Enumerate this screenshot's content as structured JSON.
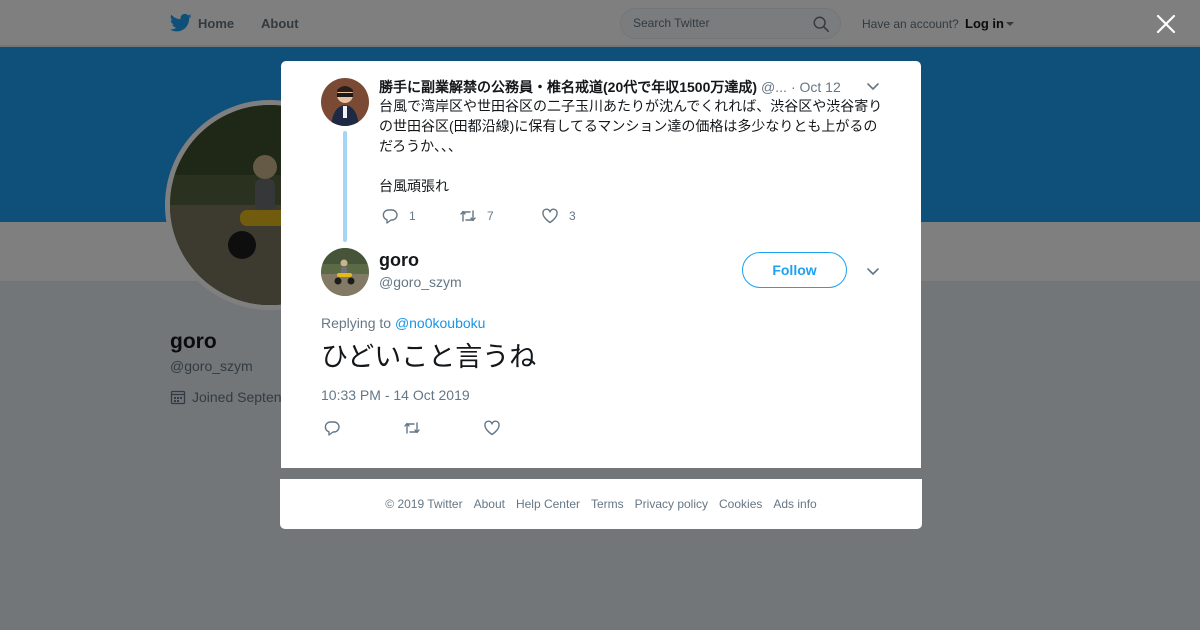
{
  "topbar": {
    "home_label": "Home",
    "about_label": "About",
    "search_placeholder": "Search Twitter",
    "account_question": "Have an account?",
    "login_label": "Log in"
  },
  "profile": {
    "name": "goro",
    "handle": "@goro_szym",
    "joined": "Joined Septen"
  },
  "parent_tweet": {
    "fullname": "勝手に副業解禁の公務員・椎名戒道(20代で年収1500万達成)",
    "username": "@...",
    "time": "· Oct 12",
    "text": "台風で湾岸区や世田谷区の二子玉川あたりが沈んでくれれば、渋谷区や渋谷寄りの世田谷区(田都沿線)に保有してるマンション達の価格は多少なりとも上がるのだろうか、、、\n\n台風頑張れ",
    "reply_count": "1",
    "retweet_count": "7",
    "like_count": "3"
  },
  "main_tweet": {
    "fullname": "goro",
    "username": "@goro_szym",
    "follow_label": "Follow",
    "replying_prefix": "Replying to ",
    "replying_to": "@no0kouboku",
    "text": "ひどいこと言うね",
    "timestamp": "10:33 PM - 14 Oct 2019"
  },
  "footer": {
    "copyright": "© 2019 Twitter",
    "links": [
      "About",
      "Help Center",
      "Terms",
      "Privacy policy",
      "Cookies",
      "Ads info"
    ]
  },
  "colors": {
    "brand": "#1da1f2",
    "thread_line": "#a3d5f7",
    "secondary_text": "#657786"
  },
  "icons": {
    "logo": "twitter-bird-icon",
    "search": "search-icon",
    "close": "close-icon",
    "reply": "reply-icon",
    "retweet": "retweet-icon",
    "like": "heart-icon",
    "more": "chevron-down-icon",
    "calendar": "calendar-icon"
  }
}
